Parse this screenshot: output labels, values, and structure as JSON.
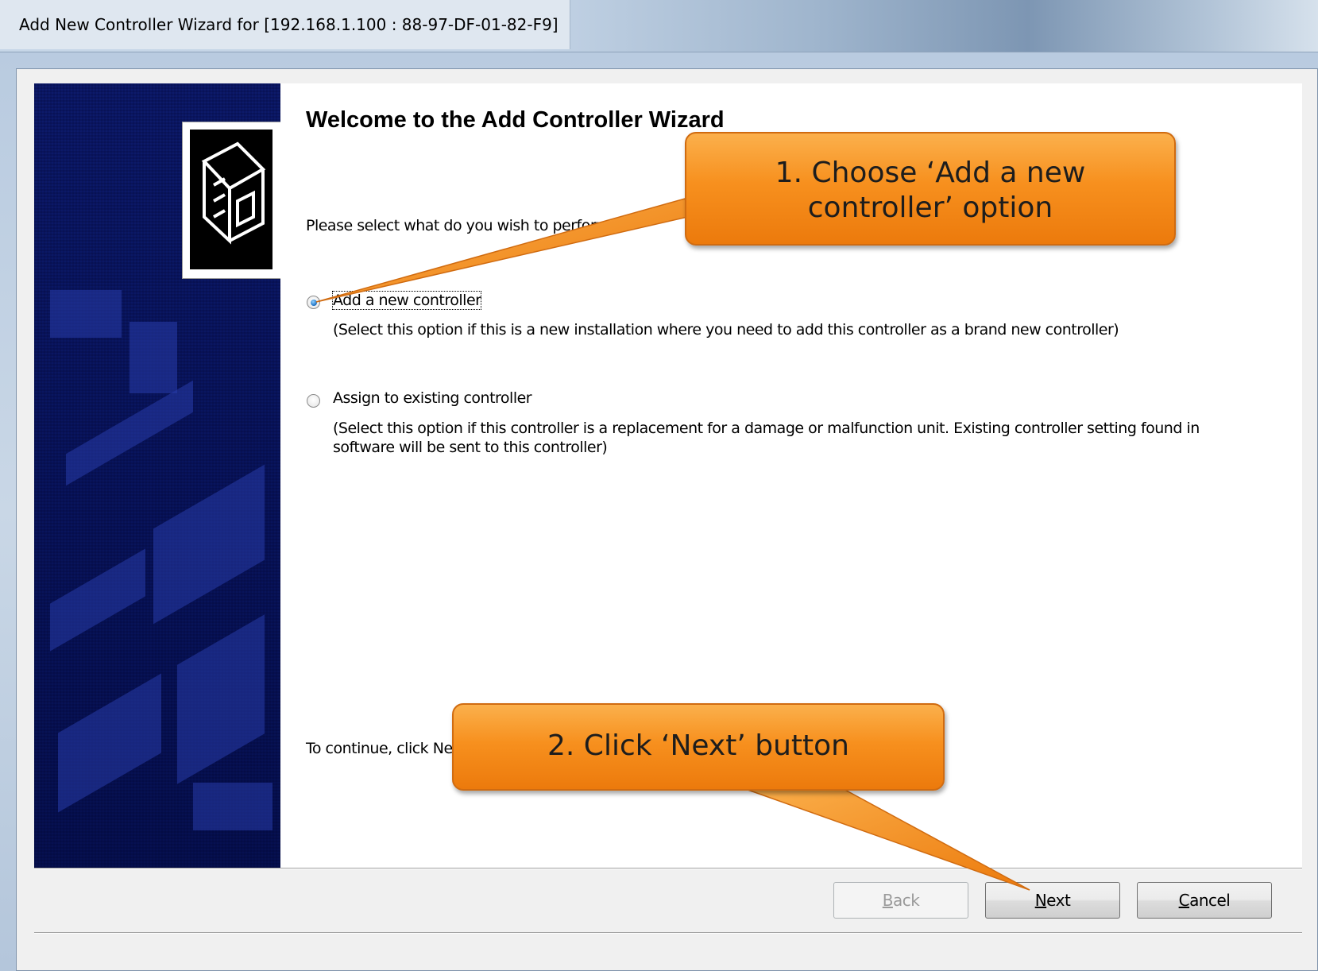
{
  "window": {
    "title": "Add New Controller Wizard for [192.168.1.100 : 88-97-DF-01-82-F9]"
  },
  "wizard": {
    "heading": "Welcome to the Add Controller Wizard",
    "prompt": "Please select what do you wish to perform",
    "options": [
      {
        "label": "Add a new controller",
        "description": "(Select this option if this is a new installation where you need to add this controller as a brand new controller)",
        "selected": true
      },
      {
        "label": "Assign to existing controller",
        "description": "(Select this option if this controller is a replacement for a damage or malfunction unit. Existing controller setting found in software will be sent to this controller)",
        "selected": false
      }
    ],
    "continue_text": "To continue, click Next."
  },
  "buttons": {
    "back": {
      "prefix": "",
      "accel": "B",
      "rest": "ack",
      "enabled": false
    },
    "next": {
      "prefix": "",
      "accel": "N",
      "rest": "ext",
      "enabled": true
    },
    "cancel": {
      "prefix": "",
      "accel": "C",
      "rest": "ancel",
      "enabled": true
    }
  },
  "callouts": {
    "step1_line1": "1. Choose ‘Add a new",
    "step1_line2": "controller’ option",
    "step2": "2. Click ‘Next’ button"
  },
  "colors": {
    "banner": "#0c1a6b",
    "callout": "#f7901e",
    "radio_selected": "#1c6fc0"
  },
  "icons": {
    "banner_logo": "wizard-hardware-logo-icon"
  }
}
